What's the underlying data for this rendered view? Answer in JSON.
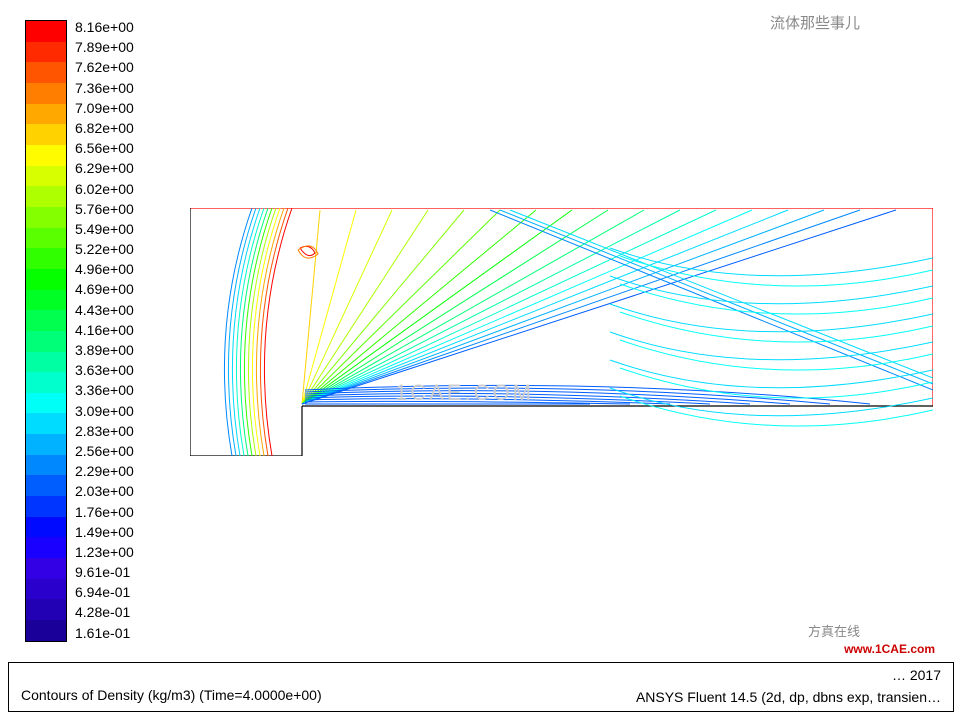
{
  "chart_data": {
    "type": "contour",
    "title": "Contours of Density (kg/m3)  (Time=4.0000e+00)",
    "software": "ANSYS Fluent 14.5 (2d, dp, dbns exp, transien…",
    "date": "… 2017",
    "variable": "Density",
    "units": "kg/m3",
    "time": 4.0,
    "colorbar_min": 0.161,
    "colorbar_max": 8.16,
    "levels": [
      "8.16e+00",
      "7.89e+00",
      "7.62e+00",
      "7.36e+00",
      "7.09e+00",
      "6.82e+00",
      "6.56e+00",
      "6.29e+00",
      "6.02e+00",
      "5.76e+00",
      "5.49e+00",
      "5.22e+00",
      "4.96e+00",
      "4.69e+00",
      "4.43e+00",
      "4.16e+00",
      "3.89e+00",
      "3.63e+00",
      "3.36e+00",
      "3.09e+00",
      "2.83e+00",
      "2.56e+00",
      "2.29e+00",
      "2.03e+00",
      "1.76e+00",
      "1.49e+00",
      "1.23e+00",
      "9.61e-01",
      "6.94e-01",
      "4.28e-01",
      "1.61e-01"
    ],
    "colors": [
      "#ff0000",
      "#ff2a00",
      "#ff5400",
      "#ff7e00",
      "#ffa800",
      "#ffd200",
      "#fffc00",
      "#d8ff00",
      "#aeff00",
      "#84ff00",
      "#5aff00",
      "#30ff00",
      "#06ff00",
      "#00ff24",
      "#00ff4e",
      "#00ff78",
      "#00ffa2",
      "#00ffcc",
      "#00fff6",
      "#00dcff",
      "#00b2ff",
      "#0088ff",
      "#005eff",
      "#0034ff",
      "#000aff",
      "#1a00ff",
      "#3300e6",
      "#2a00cc",
      "#2200b3",
      "#1a0099"
    ],
    "geometry": "forward-facing-step channel",
    "xlim": [
      0,
      3.0
    ],
    "ylim": [
      0,
      1.0
    ],
    "step_height_fraction": 0.2,
    "step_x_fraction": 0.15
  },
  "watermarks": {
    "cae": "www.1CAE.com",
    "cn1": "流体那些事儿",
    "cn2": "方真在线",
    "center": "1CAE.COM"
  }
}
